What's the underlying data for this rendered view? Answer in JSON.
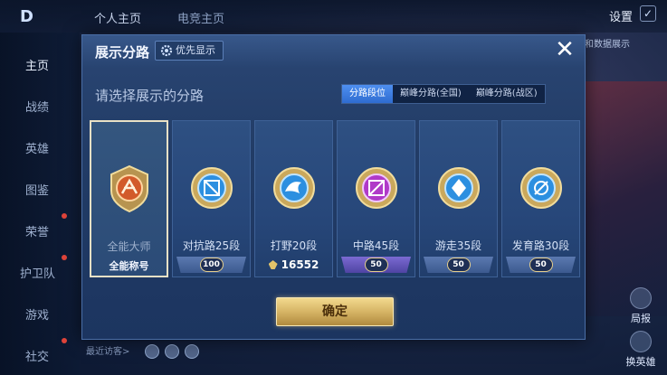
{
  "background": {
    "logo": "D",
    "tabs": [
      "个人主页",
      "电竞主页"
    ],
    "settings_label": "设置",
    "right_text": "和数据展示",
    "sidebar": [
      {
        "label": "主页",
        "active": true
      },
      {
        "label": "战绩",
        "active": false
      },
      {
        "label": "英雄",
        "active": false
      },
      {
        "label": "图鉴",
        "active": false
      },
      {
        "label": "荣誉",
        "active": false
      },
      {
        "label": "护卫队",
        "active": false
      },
      {
        "label": "游戏",
        "active": false
      },
      {
        "label": "社交",
        "active": false
      }
    ],
    "right_buttons": [
      "局报",
      "换英雄"
    ],
    "bottom_text": "最近访客>"
  },
  "dialog": {
    "title": "展示分路",
    "priority_label": "优先显示",
    "close_icon": "close-icon",
    "subtitle": "请选择展示的分路",
    "segments": [
      {
        "label": "分路段位",
        "active": true
      },
      {
        "label": "巅峰分路(全国)",
        "active": false
      },
      {
        "label": "巅峰分路(战区)",
        "active": false
      }
    ],
    "cards": [
      {
        "name": "全能大师",
        "footer": "全能称号",
        "selected": true,
        "emblem_color": "#d25a2a",
        "emblem_icon": "all-round-icon"
      },
      {
        "name": "对抗路25段",
        "rank": "100",
        "selected": false,
        "emblem_color": "#2c8fe0",
        "emblem_icon": "clash-lane-icon"
      },
      {
        "name": "打野20段",
        "peak_score": "16552",
        "selected": false,
        "emblem_color": "#2c8fe0",
        "emblem_icon": "jungle-icon"
      },
      {
        "name": "中路45段",
        "rank": "50",
        "selected": false,
        "emblem_color": "#b03ac8",
        "emblem_icon": "mid-lane-icon"
      },
      {
        "name": "游走35段",
        "rank": "50",
        "selected": false,
        "emblem_color": "#2c8fe0",
        "emblem_icon": "roam-icon"
      },
      {
        "name": "发育路30段",
        "rank": "50",
        "selected": false,
        "emblem_color": "#2c8fe0",
        "emblem_icon": "farm-lane-icon"
      }
    ],
    "confirm_label": "确定"
  },
  "colors": {
    "dialog_bg": "#223c66",
    "accent_blue": "#2f6cd0",
    "gold": "#d6b465"
  }
}
